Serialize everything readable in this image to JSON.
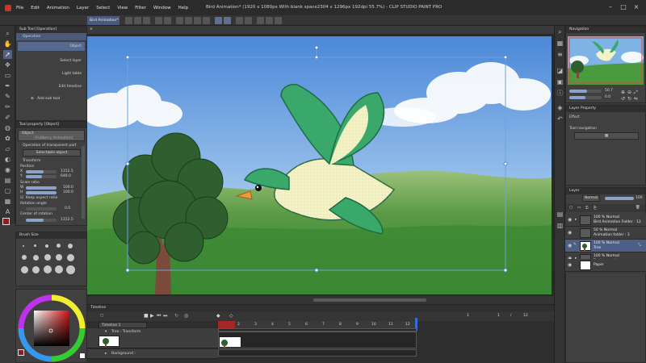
{
  "app": {
    "title": "Bird Animation* (1920 x 1080px With blank space2304 x 1296px 192dpi 55.7%) - CLIP STUDIO PAINT PRO"
  },
  "menu": [
    "File",
    "Edit",
    "Animation",
    "Layer",
    "Select",
    "View",
    "Filter",
    "Window",
    "Help"
  ],
  "tab": {
    "label": "Bird Animation*"
  },
  "subtool_panel": {
    "title": "Sub Tool [Operation]",
    "group": "Operation",
    "items": [
      "Object",
      "Select layer",
      "Light table",
      "Edit timeline"
    ],
    "add_label": "Add sub tool"
  },
  "tool_property": {
    "title": "Tool property [Object]",
    "name": "Object",
    "preview_label": "[Fullberry Animation]",
    "operation_label": "Operation of transparent part",
    "operation_value": "Selectable object",
    "transform_label": "Transform",
    "position_label": "Position",
    "x_label": "X",
    "x_value": "1152.5",
    "y_label": "Y",
    "y_value": "648.0",
    "scale_label": "Scale ratio",
    "w_label": "W",
    "w_value": "100.0",
    "h_label": "H",
    "h_value": "100.0",
    "keep_aspect": "Keep aspect ratio",
    "rotation_label": "Rotation angle",
    "rotation_value": "0.0",
    "center_label": "Center of rotation",
    "center_value": "1152.5"
  },
  "brush_size": {
    "title": "Brush Size"
  },
  "navigator": {
    "title": "Navigation",
    "zoom_value": "50.7",
    "angle_value": "0.0"
  },
  "layer_property": {
    "title": "Layer Property",
    "effect_label": "Effect",
    "tool_nav_label": "Tool navigation"
  },
  "layer_panel": {
    "title": "Layer",
    "blend": "Normal",
    "opacity": "100",
    "layers": [
      {
        "line1": "100 % Normal",
        "line2": "Bird Animation Folder : 12",
        "selected": false
      },
      {
        "line1": "50 % Normal",
        "line2": "Animation folder : 3",
        "selected": false
      },
      {
        "line1": "100 % Normal",
        "line2": "Tree",
        "selected": true
      },
      {
        "line1": "100 % Normal",
        "line2": "Background",
        "selected": false
      },
      {
        "line1": "",
        "line2": "Paper",
        "selected": false
      }
    ]
  },
  "timeline": {
    "title": "Timeline",
    "name": "Timeline 1",
    "frame_current": "1",
    "frame_sep": "/",
    "frame_total": "12",
    "frame_start": "1",
    "frame_labels": [
      "1",
      "2",
      "3",
      "4",
      "5",
      "6",
      "7",
      "8",
      "9",
      "10",
      "11",
      "12"
    ],
    "tracks": [
      {
        "label": "Tree : Transform"
      },
      {
        "label": "Background :"
      }
    ]
  },
  "canvas": {
    "sky_top": "#4b88d8",
    "sky_bottom": "#b6d3ef",
    "grass": "#3f8a35",
    "bird_green": "#3aa86b",
    "bird_cream": "#f3f1c6",
    "beak": "#e89a3c",
    "tree_green": "#2f5e2f",
    "trunk": "#7a4a3a"
  },
  "color_wheel": {
    "main": "#8b1f1f",
    "sub": "#ffffff"
  }
}
